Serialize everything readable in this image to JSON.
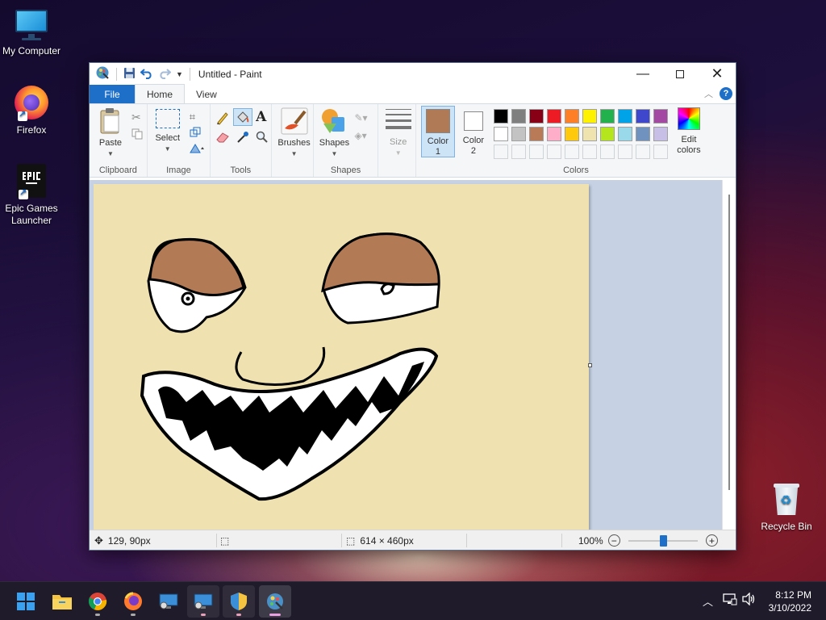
{
  "desktop": {
    "icons": [
      {
        "label": "My Computer"
      },
      {
        "label": "Firefox"
      },
      {
        "label": "Epic Games Launcher"
      },
      {
        "label": "Recycle Bin"
      }
    ]
  },
  "window": {
    "title": "Untitled - Paint",
    "tabs": {
      "file": "File",
      "home": "Home",
      "view": "View"
    },
    "ribbon": {
      "clipboard": {
        "label": "Clipboard",
        "paste": "Paste"
      },
      "image": {
        "label": "Image",
        "select": "Select"
      },
      "tools": {
        "label": "Tools"
      },
      "brushes": {
        "label": "Brushes"
      },
      "shapes": {
        "label": "Shapes",
        "button": "Shapes"
      },
      "size": {
        "label": "Size"
      },
      "color1": {
        "label": "Color",
        "label2": "1",
        "value": "#b07a56"
      },
      "color2": {
        "label": "Color",
        "label2": "2",
        "value": "#ffffff"
      },
      "colors": {
        "label": "Colors",
        "edit_label": "Edit",
        "edit_label2": "colors"
      },
      "palette_row1": [
        "#000000",
        "#7f7f7f",
        "#880015",
        "#ed1c24",
        "#ff7f27",
        "#fff200",
        "#22b14c",
        "#00a2e8",
        "#3f48cc",
        "#a349a4"
      ],
      "palette_row2": [
        "#ffffff",
        "#c3c3c3",
        "#b97a57",
        "#ffaec9",
        "#ffc90e",
        "#efe4b0",
        "#b5e61d",
        "#99d9ea",
        "#7092be",
        "#c8bfe7"
      ]
    },
    "status": {
      "cursor_pos": "129, 90px",
      "selection_size": "",
      "image_size": "614 × 460px",
      "zoom": "100%",
      "zoom_level": 0.5
    }
  },
  "taskbar": {
    "time": "8:12 PM",
    "date": "3/10/2022"
  }
}
